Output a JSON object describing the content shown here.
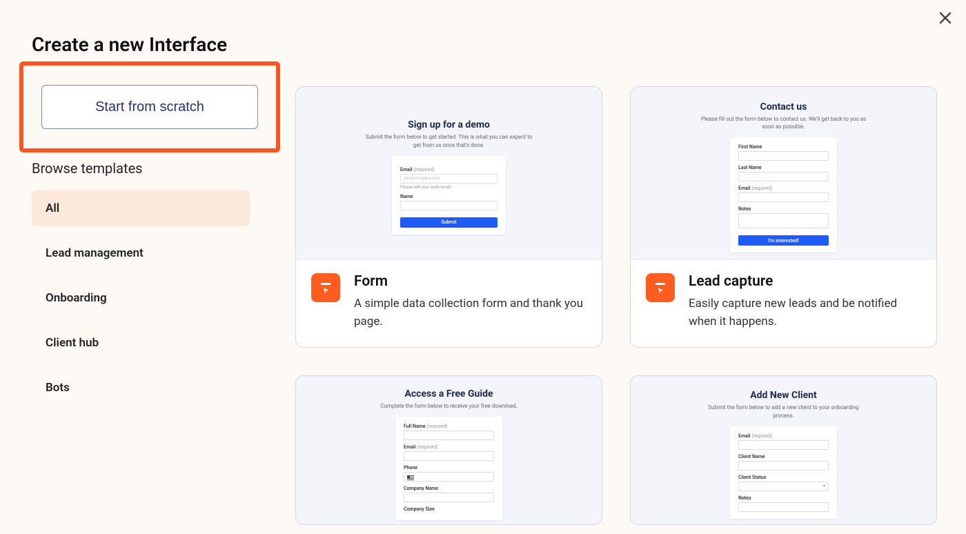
{
  "page_title": "Create a new Interface",
  "scratch_button": "Start from scratch",
  "browse_heading": "Browse templates",
  "categories": [
    {
      "label": "All",
      "active": true
    },
    {
      "label": "Lead management",
      "active": false
    },
    {
      "label": "Onboarding",
      "active": false
    },
    {
      "label": "Client hub",
      "active": false
    },
    {
      "label": "Bots",
      "active": false
    }
  ],
  "templates": [
    {
      "title": "Form",
      "desc": "A simple data collection form and thank you page.",
      "preview": {
        "heading": "Sign up for a demo",
        "sub": "Submit the form below to get started. This is what you can expect to get from us once that's done.",
        "email_label": "Email",
        "required": "(required)",
        "placeholder": "you@company.com",
        "helper": "Please add your work email.",
        "name_label": "Name",
        "submit": "Submit"
      }
    },
    {
      "title": "Lead capture",
      "desc": "Easily capture new leads and be notified when it happens.",
      "preview": {
        "heading": "Contact us",
        "sub": "Please fill out the form below to contact us. We'll get back to you as soon as possible.",
        "fn": "First Name",
        "ln": "Last Name",
        "email_label": "Email",
        "required": "(required)",
        "notes_label": "Notes",
        "submit": "I'm interested!"
      }
    },
    {
      "title": "Access a Free Guide",
      "desc": "",
      "preview": {
        "heading": "Access a Free Guide",
        "sub": "Complete the form below to receive your free download.",
        "fullname": "Full Name",
        "email_label": "Email",
        "required": "(required)",
        "phone": "Phone",
        "company": "Company Name",
        "size": "Company Size"
      }
    },
    {
      "title": "Add New Client",
      "desc": "",
      "preview": {
        "heading": "Add New Client",
        "sub": "Submit the form below to add a new client to your onboarding process.",
        "email_label": "Email",
        "required": "(required)",
        "client_name": "Client Name",
        "client_status": "Client Status",
        "notes_label": "Notes"
      }
    }
  ]
}
